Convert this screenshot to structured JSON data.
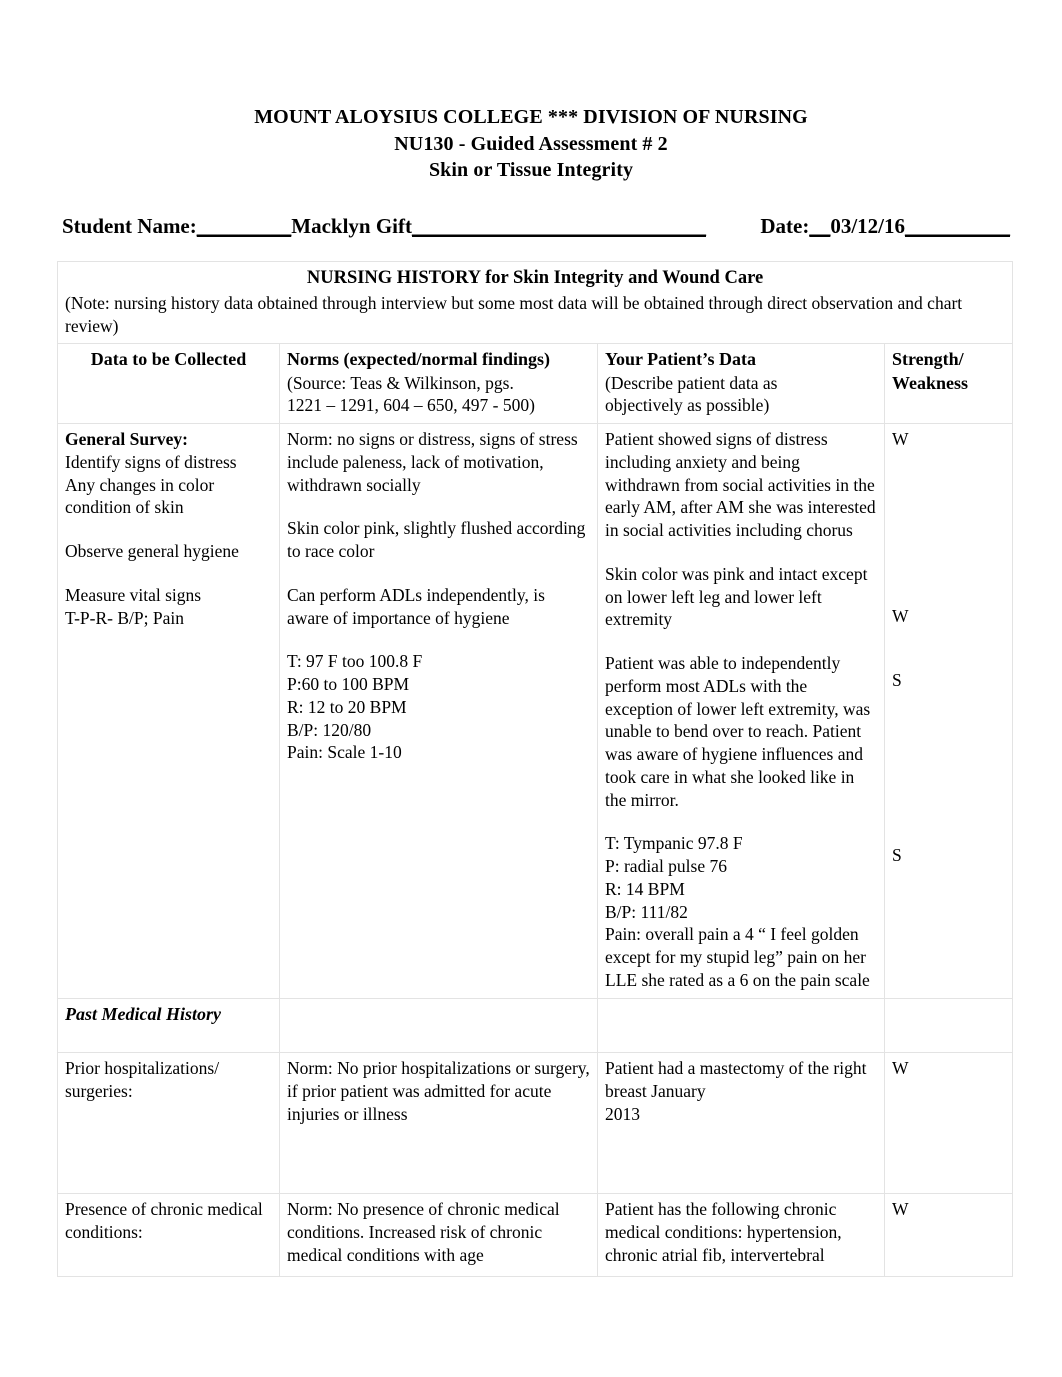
{
  "header": {
    "line1": "MOUNT ALOYSIUS COLLEGE   ***   DIVISION OF NURSING",
    "line2": "NU130 - Guided Assessment # 2",
    "line3": "Skin or Tissue Integrity"
  },
  "student_line": {
    "name_label": "Student Name:",
    "name_lead_rule": "_________",
    "name_value": "Macklyn Gift",
    "name_trail_rule": "____________________________",
    "date_label": "Date:",
    "date_lead_rule": "__",
    "date_value": "03/12/16",
    "date_trail_rule": "__________"
  },
  "banner": {
    "title": "NURSING HISTORY for Skin Integrity and Wound Care",
    "note": "(Note: nursing history data obtained through interview but some most data will be obtained through direct observation and chart review)"
  },
  "columns": [
    {
      "title": "Data to be Collected",
      "sub": ""
    },
    {
      "title": "Norms (expected/normal findings)",
      "sub_line1": " (Source: Teas & Wilkinson, pgs.",
      "sub_line2": "1221 – 1291, 604 – 650, 497 - 500)"
    },
    {
      "title": "Your Patient’s Data",
      "sub_line1": "(Describe patient data as",
      "sub_line2": "objectively as possible)"
    },
    {
      "title_line1": "Strength/",
      "title_line2": "Weakness"
    }
  ],
  "rows": [
    {
      "data_collected": {
        "heading": "General Survey:",
        "lines": [
          "Identify signs of distress",
          "Any changes in color",
          "condition of skin"
        ],
        "lines2": [
          "Observe general hygiene"
        ],
        "lines3": [
          "Measure vital signs",
          "T-P-R- B/P;  Pain"
        ]
      },
      "norms": {
        "block1": "Norm: no signs or distress, signs of stress include paleness, lack of motivation, withdrawn socially",
        "block2": "Skin color pink, slightly flushed according to race color",
        "block3": "Can perform ADLs independently, is aware of importance of hygiene",
        "vitals": [
          "T: 97 F too 100.8 F",
          "P:60 to 100 BPM",
          "R: 12 to 20 BPM",
          "B/P: 120/80",
          "Pain: Scale 1-10"
        ]
      },
      "patient_data": {
        "block1": "Patient showed signs of distress including anxiety and being withdrawn from social activities in the early AM, after AM she was interested in social activities including chorus",
        "block2": "Skin color was pink and intact except on lower left leg and lower left extremity",
        "block3": "Patient was able to independently perform most ADLs with the exception of lower left extremity, was unable to bend over to reach. Patient was aware of hygiene influences and took care in what she looked like in the mirror.",
        "vitals": [
          "T: Tympanic 97.8 F",
          "P: radial pulse 76",
          "R: 14 BPM",
          "B/P: 111/82",
          "Pain: overall pain a 4 “ I feel golden except for my stupid leg” pain on her LLE she rated as a 6 on the pain scale"
        ]
      },
      "strength_weakness": {
        "m1": "W",
        "m2": "W",
        "m3": "S",
        "m4": "S"
      }
    }
  ],
  "section_past_medical_history": "Past Medical History",
  "rows2": [
    {
      "data_collected": "Prior hospitalizations/ surgeries:",
      "norms": "Norm: No prior hospitalizations or surgery, if prior patient was admitted for acute injuries or illness",
      "patient_data_line1": "Patient had a mastectomy of the right breast January",
      "patient_data_line2": "2013",
      "strength_weakness": "W"
    },
    {
      "data_collected": "Presence of chronic medical conditions:",
      "norms": "Norm: No presence of chronic medical conditions. Increased risk of chronic medical conditions with age",
      "patient_data_line1": "Patient has the following chronic medical conditions: hypertension, chronic atrial fib, intervertebral",
      "patient_data_line2": "",
      "strength_weakness": "W"
    }
  ],
  "colors": {
    "text": "#000000",
    "border": "#e3e3e3",
    "page_background": "#ffffff"
  }
}
